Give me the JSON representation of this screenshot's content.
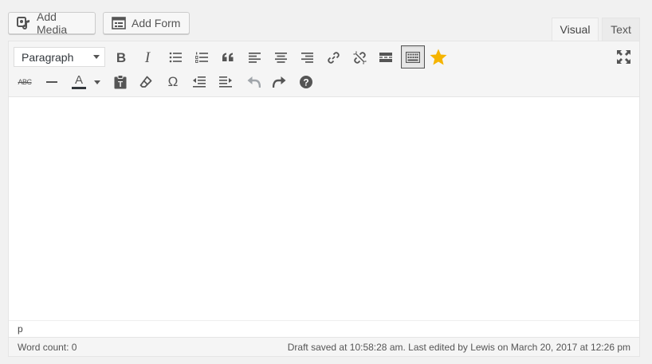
{
  "media_buttons": {
    "add_media_label": "Add Media",
    "add_form_label": "Add Form"
  },
  "editor_tabs": {
    "visual_label": "Visual",
    "text_label": "Text",
    "active": "Visual"
  },
  "toolbar": {
    "format_select_value": "Paragraph",
    "row1_icons": [
      "bold-icon",
      "italic-icon",
      "bulleted-list-icon",
      "numbered-list-icon",
      "blockquote-icon",
      "align-left-icon",
      "align-center-icon",
      "align-right-icon",
      "insert-link-icon",
      "remove-link-icon",
      "read-more-icon",
      "toolbar-toggle-icon",
      "star-icon",
      "fullscreen-icon"
    ],
    "row2_icons": [
      "strikethrough-icon",
      "horizontal-line-icon",
      "text-color-icon",
      "paste-as-text-icon",
      "clear-formatting-icon",
      "special-character-icon",
      "decrease-indent-icon",
      "increase-indent-icon",
      "undo-icon",
      "redo-icon",
      "help-icon"
    ],
    "bold_glyph": "B",
    "italic_glyph": "I",
    "strikethrough_glyph": "ABC",
    "text_color_glyph": "A",
    "special_char_glyph": "Ω",
    "toggle_active": true,
    "undo_disabled": true
  },
  "colors": {
    "star": "#f5b400",
    "icon": "#555555",
    "disabled_icon": "#a0a5aa"
  },
  "editor": {
    "path": "p",
    "word_count_text": "Word count: 0",
    "autosave_text": "Draft saved at 10:58:28 am. Last edited by Lewis on March 20, 2017 at 12:26 pm"
  }
}
